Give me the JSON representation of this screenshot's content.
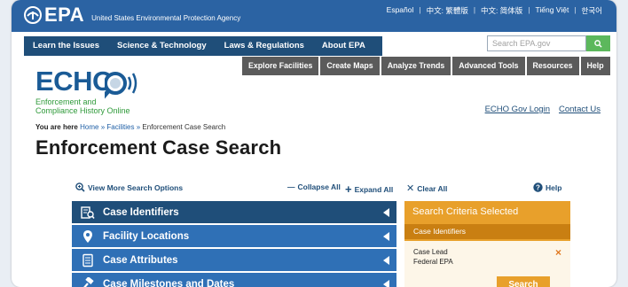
{
  "header": {
    "logo_text": "EPA",
    "agency": "United States Environmental Protection Agency",
    "languages": [
      "Español",
      "中文: 繁體版",
      "中文: 简体版",
      "Tiếng Việt",
      "한국어"
    ]
  },
  "main_nav": [
    "Learn the Issues",
    "Science & Technology",
    "Laws & Regulations",
    "About EPA"
  ],
  "search": {
    "placeholder": "Search EPA.gov"
  },
  "echo_nav": [
    "Explore Facilities",
    "Create Maps",
    "Analyze Trends",
    "Advanced Tools",
    "Resources",
    "Help"
  ],
  "echo_logo": {
    "title": "ECHO",
    "subtitle_line1": "Enforcement and",
    "subtitle_line2": "Compliance History Online"
  },
  "util_links": [
    "ECHO Gov Login",
    "Contact Us"
  ],
  "breadcrumb": {
    "prefix": "You are here",
    "items": [
      "Home",
      "Facilities"
    ],
    "current": "Enforcement Case Search",
    "sep": "»"
  },
  "page_title": "Enforcement Case Search",
  "options": {
    "view_more": "View More Search Options",
    "collapse": "Collapse All",
    "expand": "Expand All",
    "clear": "Clear All",
    "help": "Help"
  },
  "accordion": [
    {
      "label": "Case Identifiers",
      "icon": "document-search-icon"
    },
    {
      "label": "Facility Locations",
      "icon": "map-pin-icon"
    },
    {
      "label": "Case Attributes",
      "icon": "document-list-icon"
    },
    {
      "label": "Case Milestones and Dates",
      "icon": "gavel-icon"
    }
  ],
  "criteria": {
    "heading": "Search Criteria Selected",
    "section": "Case Identifiers",
    "line1": "Case Lead",
    "line2": "Federal EPA",
    "remove": "×",
    "button": "Search"
  },
  "colors": {
    "epa_blue": "#2b63a3",
    "navy": "#1f4e79",
    "orange": "#e8a02b",
    "green": "#2f9a3a"
  }
}
